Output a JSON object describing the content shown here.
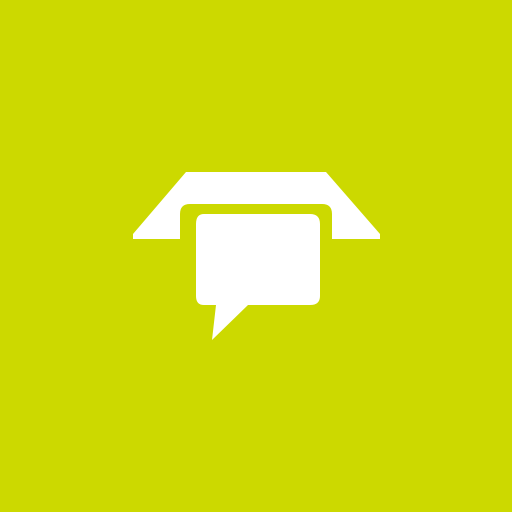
{
  "app_icon": {
    "icon_name": "phone-chat-bubble-icon",
    "background_color": "#CCD900",
    "glyph_color": "#FFFFFF"
  }
}
